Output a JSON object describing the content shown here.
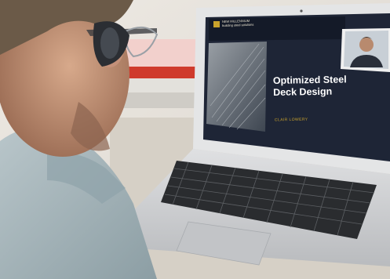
{
  "scene": {
    "description_type": "photo",
    "palette": {
      "wall": "#e9e6e1",
      "desk": "#d8d2c8",
      "laptop_body": "#cdcfd1",
      "laptop_bezel": "#e4e5e6",
      "screen_bg": "#1e2536",
      "shirt": "#a9b8bd",
      "skin": "#c99a7e",
      "red_book": "#cf3a2c"
    }
  },
  "slide": {
    "brand_line1": "NEW MILLENNIUM",
    "brand_line2": "building steel solutions",
    "title_line1": "Optimized Steel",
    "title_line2": "Deck Design",
    "presenter_line": "CLAIR LOWERY"
  },
  "video_call": {
    "participant_icon": "presenter-video-thumbnail"
  }
}
